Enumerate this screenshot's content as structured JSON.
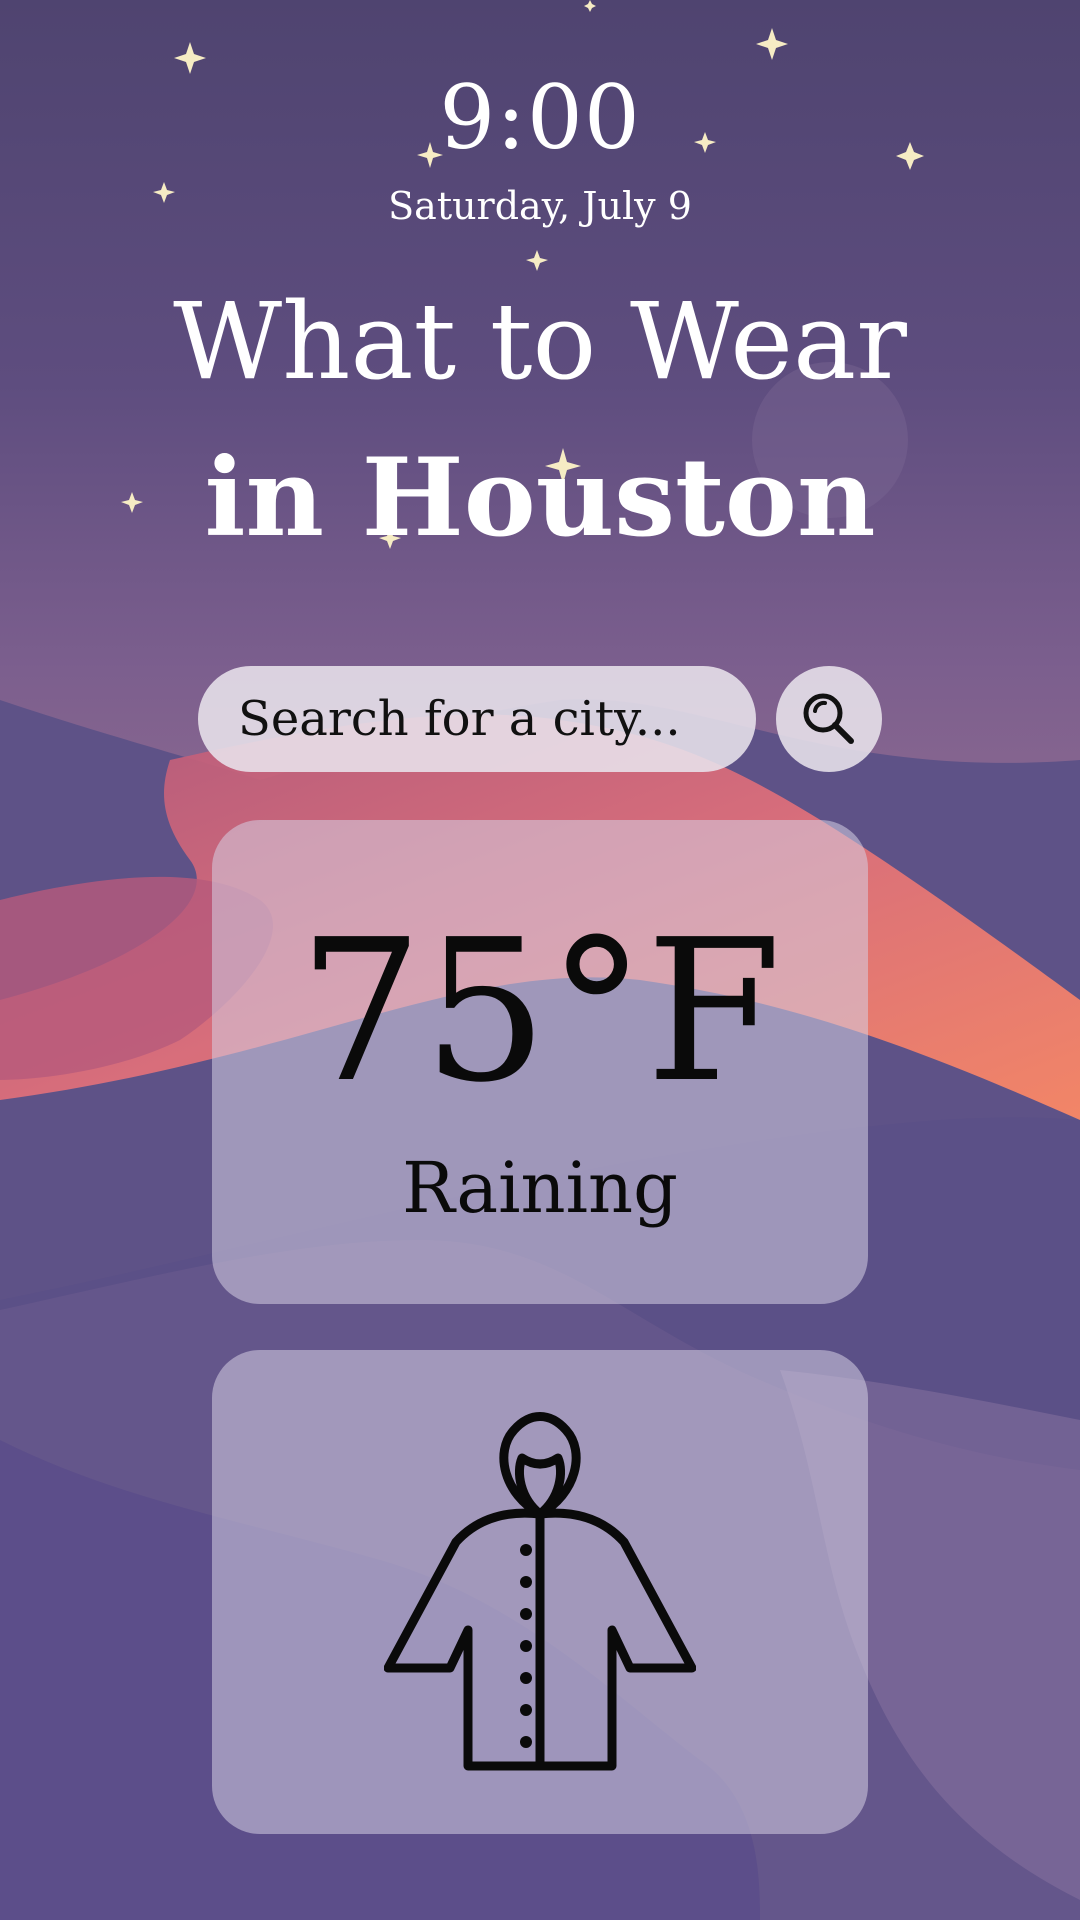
{
  "status": {
    "time": "9:00",
    "date": "Saturday, July 9"
  },
  "header": {
    "title_line1": "What to Wear",
    "title_line2": "in Houston"
  },
  "search": {
    "placeholder": "Search for a city...",
    "button_icon": "search-icon"
  },
  "weather": {
    "temperature": "75°F",
    "condition": "Raining"
  },
  "clothing": {
    "icon": "raincoat-icon"
  },
  "colors": {
    "sky_top": "#4f4470",
    "dune_pink": "#c8647a",
    "dune_orange": "#ff8a64",
    "moon": "#f3e6b8",
    "card_text": "#0a0a0a"
  }
}
